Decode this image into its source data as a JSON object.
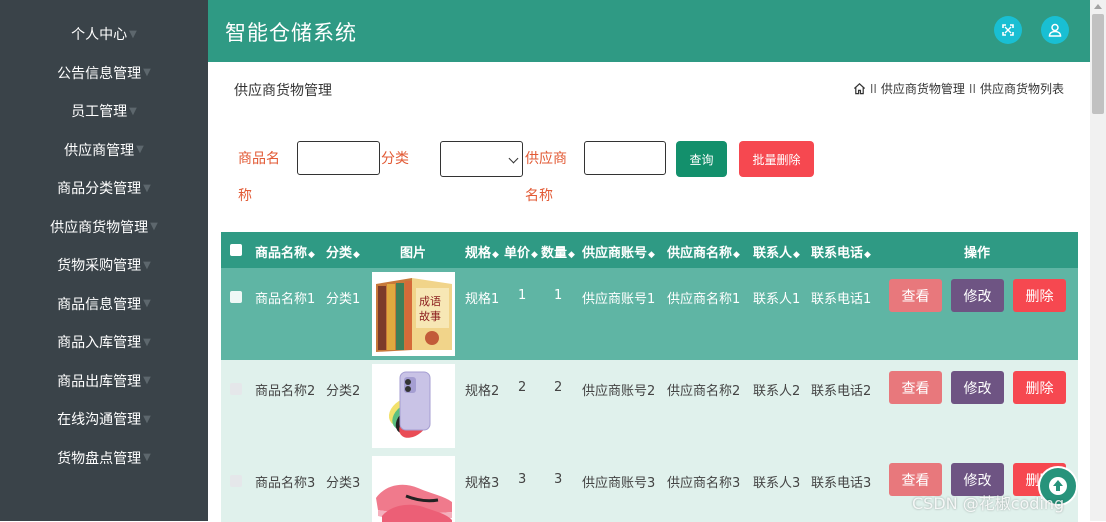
{
  "sidebar": {
    "items": [
      {
        "label": "个人中心"
      },
      {
        "label": "公告信息管理"
      },
      {
        "label": "员工管理"
      },
      {
        "label": "供应商管理"
      },
      {
        "label": "商品分类管理"
      },
      {
        "label": "供应商货物管理"
      },
      {
        "label": "货物采购管理"
      },
      {
        "label": "商品信息管理"
      },
      {
        "label": "商品入库管理"
      },
      {
        "label": "商品出库管理"
      },
      {
        "label": "在线沟通管理"
      },
      {
        "label": "货物盘点管理"
      }
    ]
  },
  "header": {
    "title": "智能仓储系统",
    "icons": [
      "fullscreen-icon",
      "user-icon"
    ]
  },
  "page": {
    "title": "供应商货物管理",
    "breadcrumb": [
      "供应商货物管理",
      "供应商货物列表"
    ]
  },
  "search": {
    "product_name_label_1": "商品名",
    "product_name_label_2": "称",
    "category_label": "分类",
    "supplier_name_label_1": "供应商",
    "supplier_name_label_2": "名称",
    "query_button": "查询",
    "batch_delete_button": "批量删除"
  },
  "table": {
    "headers": [
      "商品名称",
      "分类",
      "图片",
      "规格",
      "单价",
      "数量",
      "供应商账号",
      "供应商名称",
      "联系人",
      "联系电话",
      "操作"
    ],
    "rows": [
      {
        "name": "商品名称1",
        "category": "分类1",
        "image": "成语故事 book set",
        "spec": "规格1",
        "price": "1",
        "qty": "1",
        "account": "供应商账号1",
        "supplier": "供应商名称1",
        "contact": "联系人1",
        "phone": "联系电话1"
      },
      {
        "name": "商品名称2",
        "category": "分类2",
        "image": "smartphones",
        "spec": "规格2",
        "price": "2",
        "qty": "2",
        "account": "供应商账号2",
        "supplier": "供应商名称2",
        "contact": "联系人2",
        "phone": "联系电话2"
      },
      {
        "name": "商品名称3",
        "category": "分类3",
        "image": "pink sneakers",
        "spec": "规格3",
        "price": "3",
        "qty": "3",
        "account": "供应商账号3",
        "supplier": "供应商名称3",
        "contact": "联系人3",
        "phone": "联系电话3"
      }
    ],
    "actions": {
      "view": "查看",
      "edit": "修改",
      "delete": "删除"
    }
  },
  "watermark": "CSDN @花椒coding",
  "colors": {
    "sidebar": "#3a4349",
    "header": "#2f9a84",
    "query_button": "#13906c",
    "delete_button": "#f64850",
    "view_button": "#e8787c",
    "edit_button": "#6e5483"
  }
}
